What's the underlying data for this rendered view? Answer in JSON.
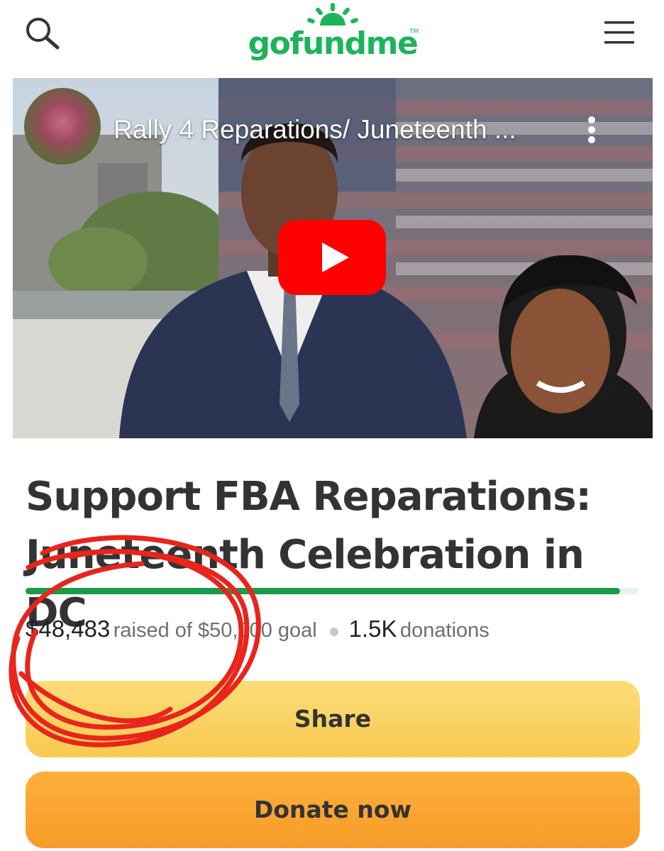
{
  "header": {
    "logo_text": "gofundme",
    "trademark": "TM"
  },
  "video": {
    "title": "Rally 4 Reparations/ Juneteenth ..."
  },
  "campaign": {
    "title": "Support FBA Reparations: Juneteenth Celebration in DC",
    "raised_amount": "$48,483",
    "raised_text": "raised of $50,000 goal",
    "donation_count": "1.5K",
    "donation_label": "donations",
    "progress_fraction": 0.97
  },
  "buttons": {
    "share_label": "Share",
    "donate_label": "Donate now"
  },
  "colors": {
    "brand_green": "#1db35a",
    "progress_green": "#1a9b4b",
    "share_yellow": "#f7c94f",
    "donate_orange": "#f89b29",
    "play_red": "#ff0000",
    "annotation_red": "#e8251c"
  },
  "icons": {
    "search": "search-icon",
    "menu": "hamburger-menu-icon",
    "play": "play-icon",
    "more": "more-vertical-icon"
  }
}
